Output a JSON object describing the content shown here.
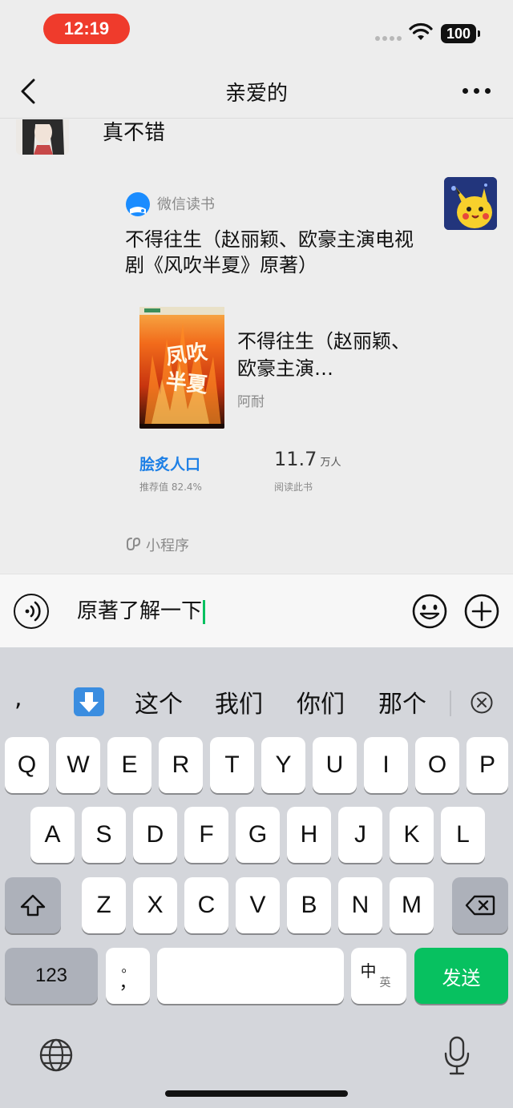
{
  "status_bar": {
    "time": "12:19",
    "battery": "100"
  },
  "nav": {
    "title": "亲爱的"
  },
  "chat": {
    "message_text": "真不错",
    "miniprogram": {
      "source": "微信读书",
      "title": "不得往生（赵丽颖、欧豪主演电视剧《风吹半夏》原著）",
      "book": {
        "cover_text": "凤吹半夏",
        "title": "不得往生（赵丽颖、欧豪主演…",
        "author": "阿耐"
      },
      "recommend_label": "脍炙人口",
      "recommend_sub": "推荐值 82.4%",
      "read_count": "11.7",
      "read_unit": "万人",
      "read_sub": "阅读此书",
      "footer": "小程序"
    }
  },
  "input": {
    "value": "原著了解一下"
  },
  "keyboard": {
    "candidates": [
      "这个",
      "我们",
      "你们",
      "那个"
    ],
    "candidate_comma": ",",
    "rows": [
      [
        "Q",
        "W",
        "E",
        "R",
        "T",
        "Y",
        "U",
        "I",
        "O",
        "P"
      ],
      [
        "A",
        "S",
        "D",
        "F",
        "G",
        "H",
        "J",
        "K",
        "L"
      ],
      [
        "Z",
        "X",
        "C",
        "V",
        "B",
        "N",
        "M"
      ]
    ],
    "numbers_key": "123",
    "punct_key": "，",
    "punct_key_top": "。",
    "lang_key_main": "中",
    "lang_key_sub": "英",
    "send_key": "发送"
  },
  "colors": {
    "accent": "#07c160",
    "time_pill": "#ef3b2c",
    "recommend": "#1e80e6"
  }
}
